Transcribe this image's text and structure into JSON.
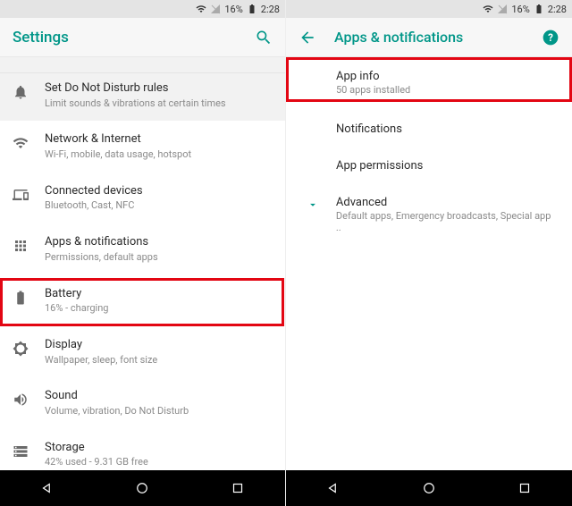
{
  "status": {
    "battery": "16%",
    "time": "2:28"
  },
  "left": {
    "title": "Settings",
    "rows": [
      {
        "icon": "bell",
        "title": "Set Do Not Disturb rules",
        "sub": "Limit sounds & vibrations at certain times"
      },
      {
        "icon": "wifi",
        "title": "Network & Internet",
        "sub": "Wi-Fi, mobile, data usage, hotspot"
      },
      {
        "icon": "devices",
        "title": "Connected devices",
        "sub": "Bluetooth, Cast, NFC"
      },
      {
        "icon": "apps",
        "title": "Apps & notifications",
        "sub": "Permissions, default apps"
      },
      {
        "icon": "battery",
        "title": "Battery",
        "sub": "16% - charging"
      },
      {
        "icon": "display",
        "title": "Display",
        "sub": "Wallpaper, sleep, font size"
      },
      {
        "icon": "sound",
        "title": "Sound",
        "sub": "Volume, vibration, Do Not Disturb"
      },
      {
        "icon": "storage",
        "title": "Storage",
        "sub": "42% used - 9.31 GB free"
      }
    ]
  },
  "right": {
    "title": "Apps & notifications",
    "rows": [
      {
        "title": "App info",
        "sub": "50 apps installed"
      },
      {
        "title": "Notifications"
      },
      {
        "title": "App permissions"
      },
      {
        "title": "Advanced",
        "sub": "Default apps, Emergency broadcasts, Special app .."
      }
    ]
  }
}
